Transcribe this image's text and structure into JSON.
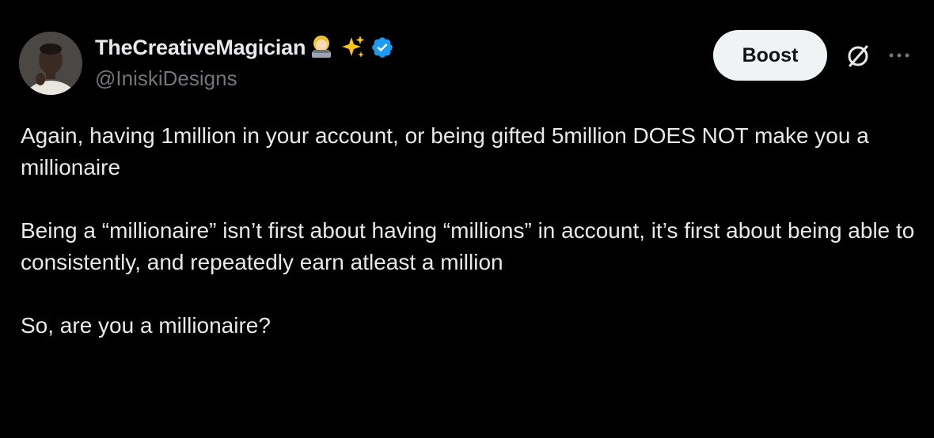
{
  "author": {
    "display_name": "TheCreativeMagician",
    "emoji_icons": [
      "woman-technologist-emoji-icon",
      "sparkles-emoji-icon"
    ],
    "verified_icon": "verified-badge-icon",
    "handle": "@IniskiDesigns"
  },
  "actions": {
    "boost_label": "Boost",
    "grok_icon": "grok-slash-circle-icon",
    "more_icon": "more-dots-icon"
  },
  "tweet": {
    "paragraphs": [
      "Again, having 1million in your account, or being gifted 5million DOES NOT make you a millionaire",
      "Being a “millionaire” isn’t first about having “millions” in account, it’s first about being able to consistently, and repeatedly earn atleast a million",
      "So, are you a millionaire?"
    ]
  },
  "colors": {
    "background": "#000000",
    "text_primary": "#e7e9ea",
    "text_secondary": "#71767b",
    "verified_blue": "#1d9bf0",
    "button_bg": "#eff3f4",
    "button_text": "#0f1419"
  }
}
